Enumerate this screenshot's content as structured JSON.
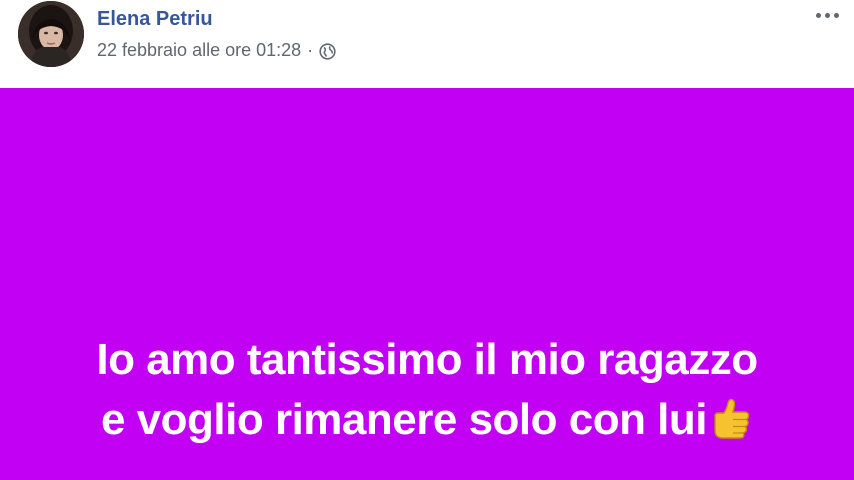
{
  "header": {
    "author_name": "Elena Petriu",
    "timestamp": "22 febbraio alle ore 01:28",
    "separator": "·",
    "privacy_icon": "globe-icon",
    "options_icon": "more-options-icon"
  },
  "post": {
    "background_color": "#c100f4",
    "text_color": "#ffffff",
    "lines": [
      "Io amo tantissimo il mio ragazzo",
      "e voglio rimanere solo con lui"
    ],
    "trailing_emoji": "thumbs-up-icon"
  },
  "colors": {
    "author_link": "#365899",
    "meta_text": "#606770"
  }
}
